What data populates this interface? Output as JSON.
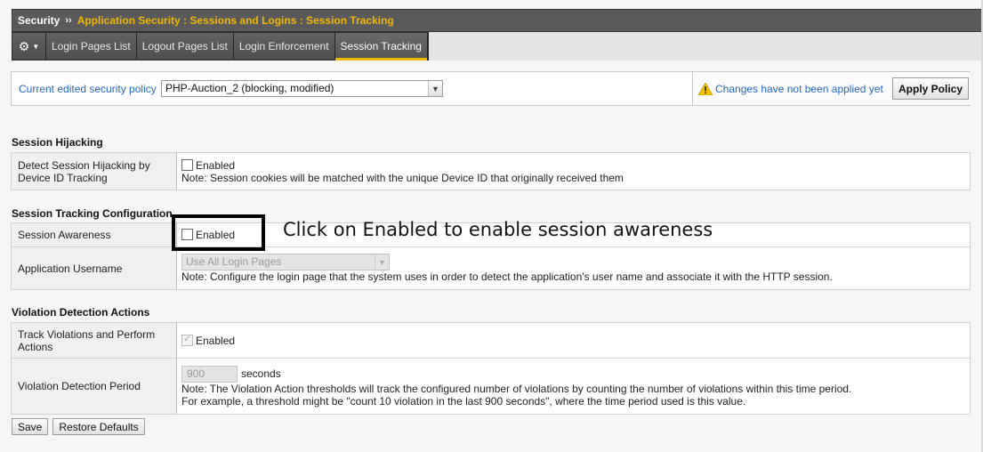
{
  "breadcrumb": {
    "root": "Security",
    "separator": "››",
    "path": "Application Security : Sessions and Logins : Session Tracking"
  },
  "tabs": [
    {
      "label": "Login Pages List",
      "active": false
    },
    {
      "label": "Logout Pages List",
      "active": false
    },
    {
      "label": "Login Enforcement",
      "active": false
    },
    {
      "label": "Session Tracking",
      "active": true
    }
  ],
  "policy_bar": {
    "label": "Current edited security policy",
    "selected_policy": "PHP-Auction_2 (blocking, modified)",
    "warning_text": "Changes have not been applied yet",
    "apply_label": "Apply Policy"
  },
  "session_hijacking": {
    "title": "Session Hijacking",
    "row_label": "Detect Session Hijacking by Device ID Tracking",
    "checkbox_label": "Enabled",
    "note": "Note: Session cookies will be matched with the unique Device ID that originally received them"
  },
  "session_tracking": {
    "title": "Session Tracking Configuration",
    "awareness_label": "Session Awareness",
    "awareness_checkbox": "Enabled",
    "username_label": "Application Username",
    "username_select": "Use All Login Pages",
    "username_note": "Note: Configure the login page that the system uses in order to detect the application's user name and associate it with the HTTP session."
  },
  "violation_detection": {
    "title": "Violation Detection Actions",
    "track_label": "Track Violations and Perform Actions",
    "track_checkbox": "Enabled",
    "period_label": "Violation Detection Period",
    "period_value": "900",
    "period_unit": "seconds",
    "period_note_1": "Note: The Violation Action thresholds will track the configured number of violations by counting the number of violations within this time period.",
    "period_note_2": "For example, a threshold might be \"count 10 violation in the last 900 seconds\", where the time period used is this value."
  },
  "annotation": {
    "text": "Click on Enabled to enable session awareness"
  },
  "buttons": {
    "save": "Save",
    "restore": "Restore Defaults"
  },
  "colors": {
    "accent": "#f2b400",
    "link_blue": "#2667c2",
    "titlebar_bg": "#5a5a5a"
  },
  "icons": {
    "settings": "gear-icon",
    "warning": "warning-triangle-icon",
    "dropdown": "chevron-down-icon"
  }
}
